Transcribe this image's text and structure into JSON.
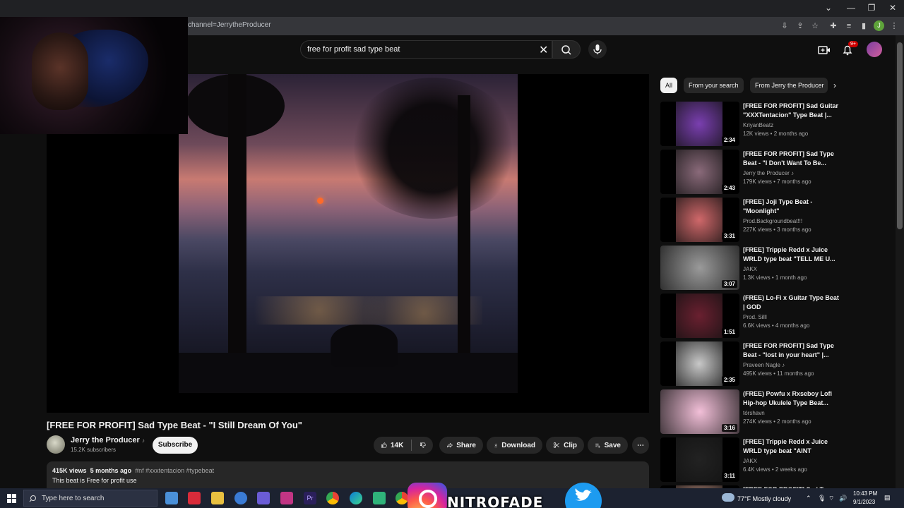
{
  "browser": {
    "url_partial": "channel=JerrytheProducer",
    "profile_initial": "J"
  },
  "search": {
    "query": "free for profit sad type beat"
  },
  "notifications": {
    "badge": "9+"
  },
  "video": {
    "title": "[FREE FOR PROFIT] Sad Type Beat - \"I Still Dream Of You\"",
    "channel": "Jerry the Producer",
    "channel_badge": "♪",
    "subscribers": "15.2K subscribers",
    "subscribe_label": "Subscribe",
    "likes": "14K",
    "share_label": "Share",
    "download_label": "Download",
    "clip_label": "Clip",
    "save_label": "Save",
    "more_label": "⋯",
    "views": "415K views",
    "age": "5 months ago",
    "tags": "#nf #xxxtentacion #typebeat",
    "description": "This beat is Free for profit use"
  },
  "chips": [
    "All",
    "From your search",
    "From Jerry the Producer"
  ],
  "chip_next": "›",
  "recommendations": [
    {
      "title": "[FREE FOR PROFIT] Sad Guitar \"XXXTentacion\" Type Beat |...",
      "channel": "KriyanBeatz",
      "meta": "12K views • 2 months ago",
      "duration": "2:34",
      "art": "#7a3fb0"
    },
    {
      "title": "[FREE FOR PROFIT] Sad Type Beat - \"I Don't Want To Be...",
      "channel": "Jerry the Producer ♪",
      "meta": "179K views • 7 months ago",
      "duration": "2:43",
      "art": "#8a6a7a"
    },
    {
      "title": "[FREE] Joji Type Beat - \"Moonlight\"",
      "channel": "Prod.Backgroundbeat!!!",
      "meta": "227K views • 3 months ago",
      "duration": "3:31",
      "art": "#d0686a"
    },
    {
      "title": "[FREE] Trippie Redd x Juice WRLD type beat \"TELL ME U...",
      "channel": "JAKX",
      "meta": "1.3K views • 1 month ago",
      "duration": "3:07",
      "art": "#9a9a9a"
    },
    {
      "title": "(FREE) Lo-Fi x Guitar Type Beat | GOD",
      "channel": "Prod. Silll",
      "meta": "6.6K views • 4 months ago",
      "duration": "1:51",
      "art": "#6a2030"
    },
    {
      "title": "[FREE FOR PROFIT] Sad Type Beat - \"lost in your heart\" |...",
      "channel": "Praveen Nagle ♪",
      "meta": "495K views • 11 months ago",
      "duration": "2:35",
      "art": "#c8c8c8"
    },
    {
      "title": "(FREE) Powfu x Rxseboy Lofi Hip-hop Ukulele Type Beat...",
      "channel": "tórshavn",
      "meta": "274K views • 2 months ago",
      "duration": "3:16",
      "art": "#f2bfd8"
    },
    {
      "title": "[FREE] Trippie Redd x Juice WRLD type beat \"AINT ENOUGH\"",
      "channel": "JAKX",
      "meta": "6.4K views • 2 weeks ago",
      "duration": "3:11",
      "art": "#222222"
    },
    {
      "title": "[FREE FOR PROFIT] Sad Type...",
      "channel": "",
      "meta": "",
      "duration": "",
      "art": "#c09080"
    }
  ],
  "taskbar": {
    "search_placeholder": "Type here to search",
    "weather": "77°F  Mostly cloudy",
    "time": "10:43 PM",
    "date": "9/1/2023"
  },
  "overlay": {
    "brand": "NITROFADE"
  }
}
